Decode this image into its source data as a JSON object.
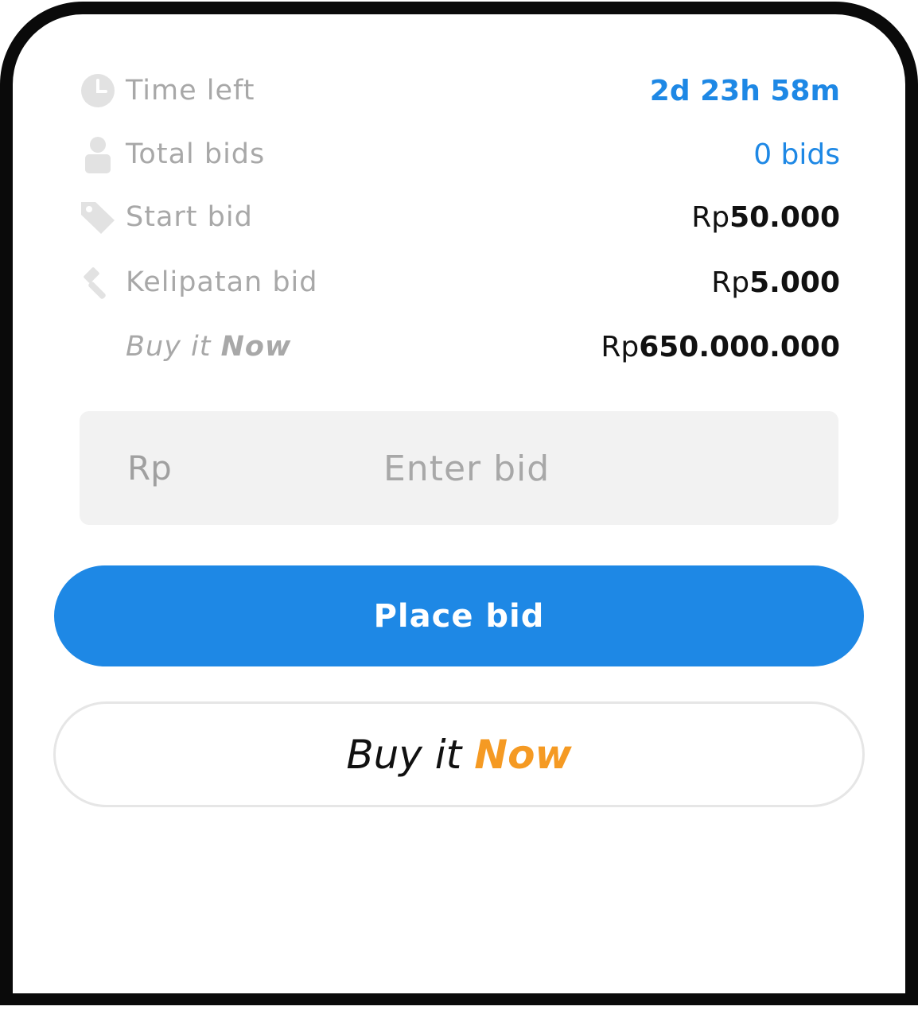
{
  "details": {
    "time_left": {
      "label": "Time left",
      "value": "2d 23h 58m",
      "icon": "clock-icon"
    },
    "total_bids": {
      "label": "Total bids",
      "value": "0 bids",
      "icon": "user-icon"
    },
    "start_bid": {
      "label": "Start bid",
      "currency": "Rp",
      "amount": "50.000",
      "icon": "tag-icon"
    },
    "bid_increment": {
      "label": "Kelipatan bid",
      "currency": "Rp",
      "amount": "5.000",
      "icon": "gavel-icon"
    },
    "buy_it_now": {
      "label_part1": "Buy it",
      "label_part2": "Now",
      "currency": "Rp",
      "amount": "650.000.000"
    }
  },
  "bid_input": {
    "currency": "Rp",
    "placeholder": "Enter bid",
    "value": ""
  },
  "buttons": {
    "place_bid": "Place bid",
    "buy_now_part1": "Buy it",
    "buy_now_part2": "Now"
  },
  "colors": {
    "accent": "#1e88e5",
    "buy_now_accent": "#f59a23",
    "label_gray": "#a8a8a8"
  }
}
